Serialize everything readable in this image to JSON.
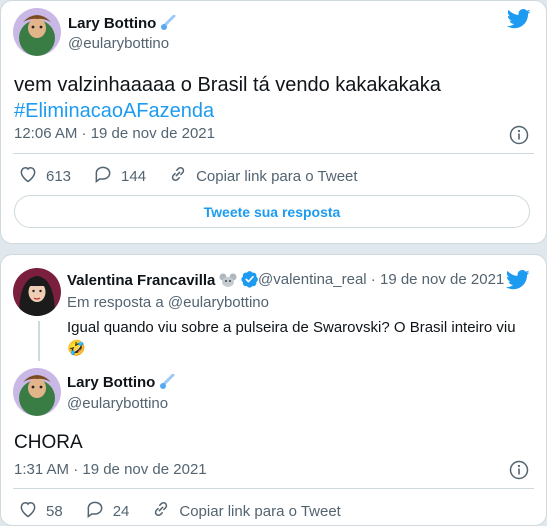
{
  "tweet1": {
    "name": "Lary Bottino",
    "handle": "@eularybottino",
    "text": "vem valzinhaaaaa o Brasil tá vendo kakakakaka",
    "hashtag": "#EliminacaoAFazenda",
    "time": "12:06 AM · 19 de nov de 2021",
    "likes": "613",
    "replies": "144",
    "copy_link": "Copiar link para o Tweet",
    "reply_button": "Tweete sua resposta"
  },
  "reply": {
    "name": "Valentina Francavilla",
    "handle": "@valentina_real",
    "date": " · 19 de nov de 2021",
    "in_reply_to": "Em resposta a @eularybottino",
    "text_line1": "Igual quando viu sobre a pulseira de Swarovski? O Brasil inteiro viu",
    "emoji": "🤣"
  },
  "tweet2": {
    "name": "Lary Bottino",
    "handle": "@eularybottino",
    "text": "CHORA",
    "time": "1:31 AM · 19 de nov de 2021",
    "likes": "58",
    "replies": "24",
    "copy_link": "Copiar link para o Tweet"
  },
  "icons": {
    "bird": "twitter-bird-icon",
    "heart": "heart-icon",
    "reply": "reply-bubble-icon",
    "link": "link-icon",
    "info": "info-icon",
    "comet": "comet-emoji-icon",
    "mouse": "mouse-emoji-icon",
    "verified": "verified-badge-icon"
  },
  "colors": {
    "accent": "#1d9bf0",
    "secondary_text": "#536471",
    "border": "#cfd9de"
  }
}
